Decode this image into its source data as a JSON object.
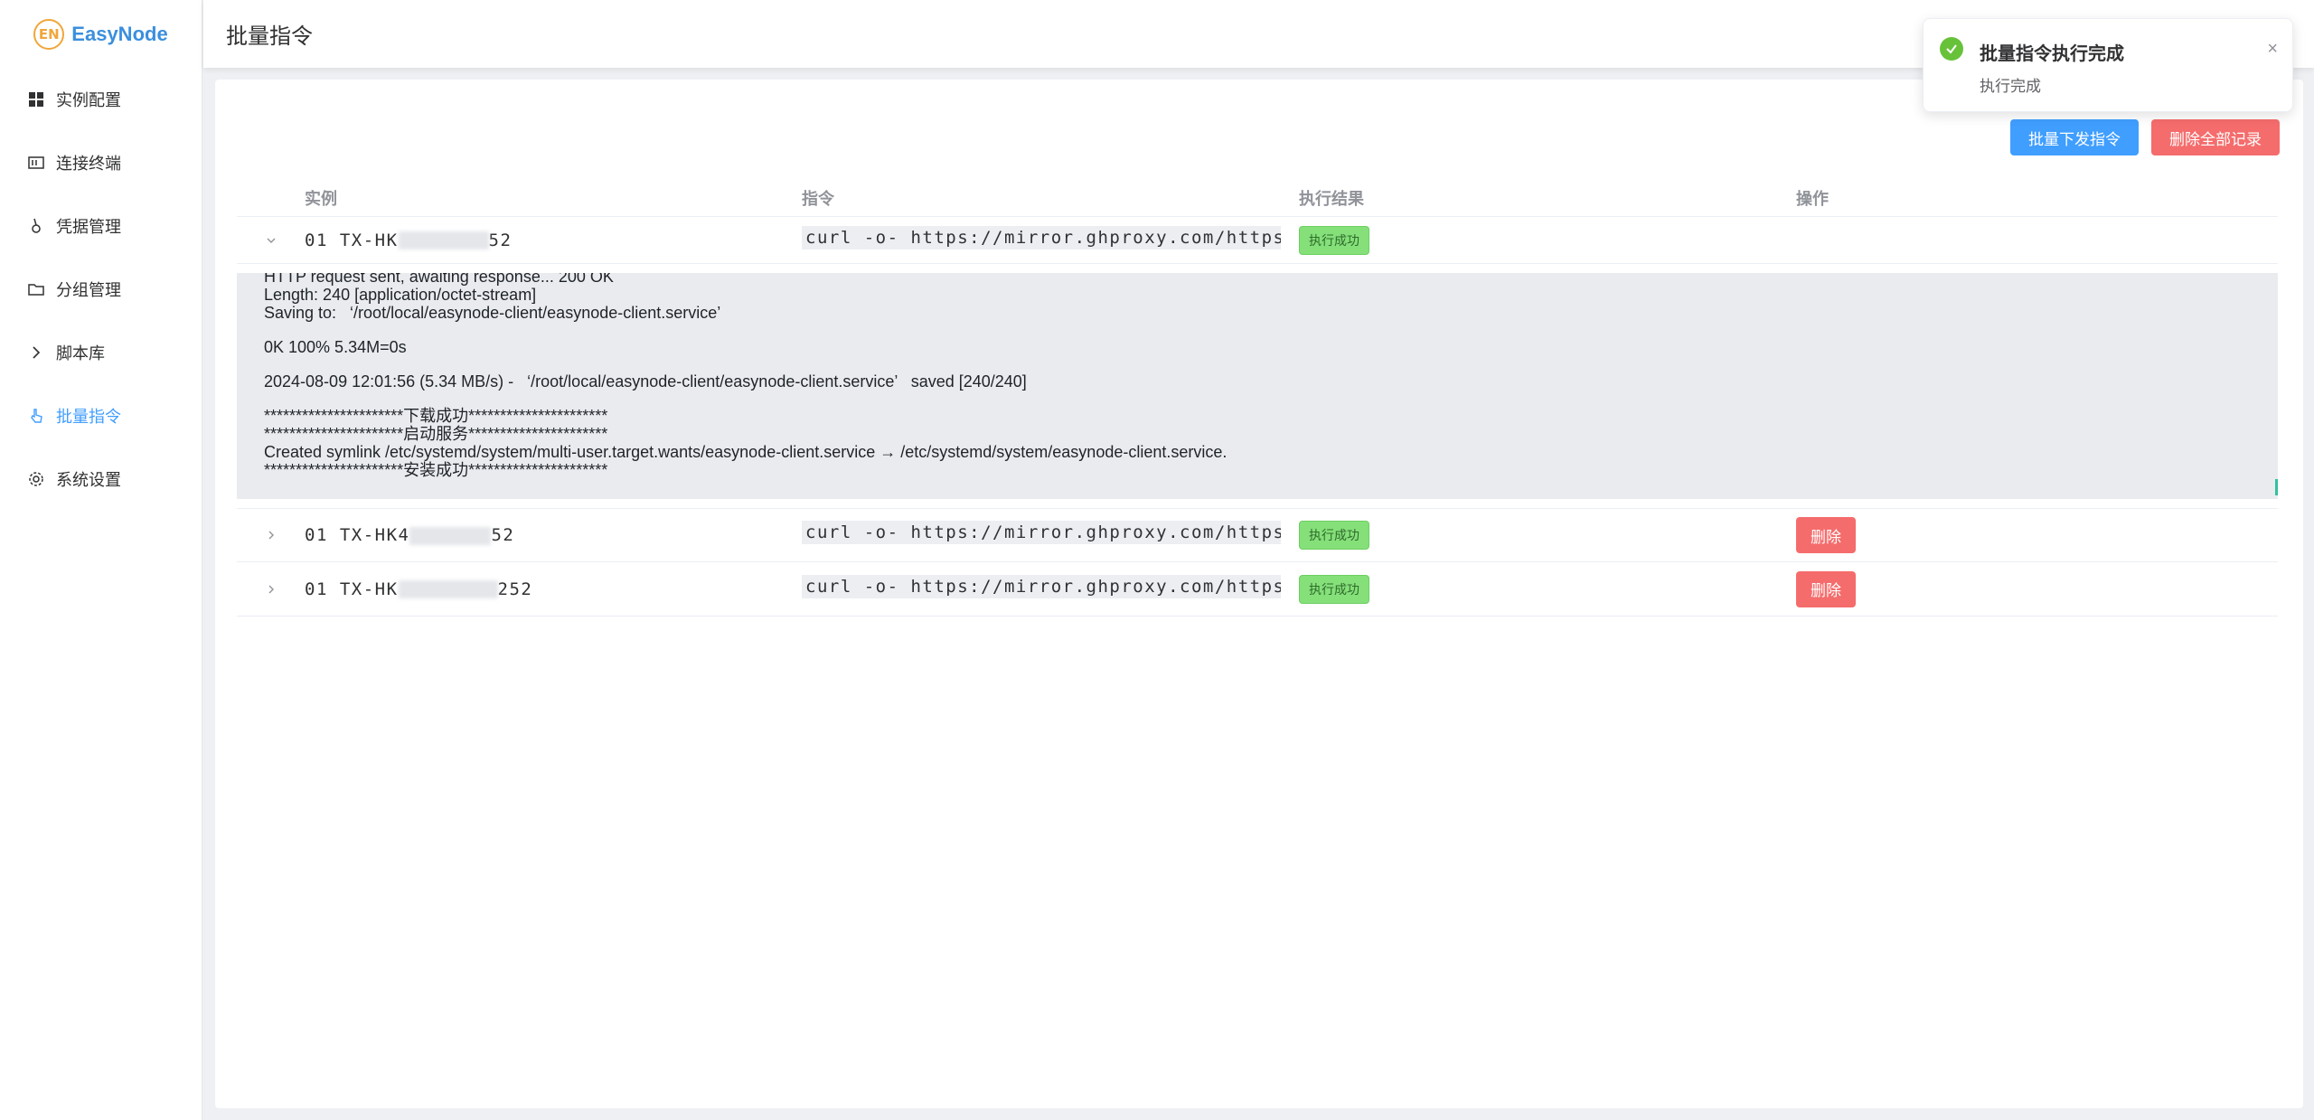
{
  "app": {
    "logo_mark": "EN",
    "name": "EasyNode"
  },
  "sidebar": {
    "items": [
      {
        "label": "实例配置",
        "icon": "grid-icon",
        "active": false
      },
      {
        "label": "连接终端",
        "icon": "terminal-icon",
        "active": false
      },
      {
        "label": "凭据管理",
        "icon": "key-icon",
        "active": false
      },
      {
        "label": "分组管理",
        "icon": "folder-icon",
        "active": false
      },
      {
        "label": "脚本库",
        "icon": "chevron-right-icon",
        "active": false
      },
      {
        "label": "批量指令",
        "icon": "pointer-icon",
        "active": true
      },
      {
        "label": "系统设置",
        "icon": "gear-icon",
        "active": false
      }
    ]
  },
  "header": {
    "title": "批量指令"
  },
  "toolbar": {
    "batch_send_label": "批量下发指令",
    "delete_all_label": "删除全部记录"
  },
  "table": {
    "headers": {
      "instance": "实例",
      "command": "指令",
      "result": "执行结果",
      "operation": "操作"
    },
    "rows": [
      {
        "instance_prefix": "01 TX-HK",
        "instance_suffix": "52",
        "command": "curl -o- https://mirror.ghproxy.com/https://ra…",
        "status": "执行成功",
        "delete_label": "",
        "expanded": true
      },
      {
        "instance_prefix": "01 TX-HK4",
        "instance_suffix": "52",
        "command": "curl -o- https://mirror.ghproxy.com/https://ra…",
        "status": "执行成功",
        "delete_label": "删除",
        "expanded": false
      },
      {
        "instance_prefix": "01 TX-HK",
        "instance_suffix": "252",
        "command": "curl -o- https://mirror.ghproxy.com/https://ra…",
        "status": "执行成功",
        "delete_label": "删除",
        "expanded": false
      }
    ],
    "output_lines": {
      "l0": "HTTP request sent, awaiting response... 200 OK",
      "l1": "Length: 240 [application/octet-stream]",
      "l2": "Saving to:   ‘/root/local/easynode-client/easynode-client.service’",
      "l3": "0K 100% 5.34M=0s",
      "l4": "2024-08-09 12:01:56 (5.34 MB/s) -   ‘/root/local/easynode-client/easynode-client.service’   saved [240/240]",
      "l5": "**********************下载成功**********************",
      "l6": "**********************启动服务**********************",
      "l7": "Created symlink /etc/systemd/system/multi-user.target.wants/easynode-client.service → /etc/systemd/system/easynode-client.service.",
      "l8": "**********************安装成功**********************"
    }
  },
  "notification": {
    "title": "批量指令执行完成",
    "message": "执行完成",
    "close": "×"
  },
  "colors": {
    "primary": "#409eff",
    "danger": "#f56c6c",
    "success": "#67c23a",
    "success_tag": "#85e07a"
  }
}
